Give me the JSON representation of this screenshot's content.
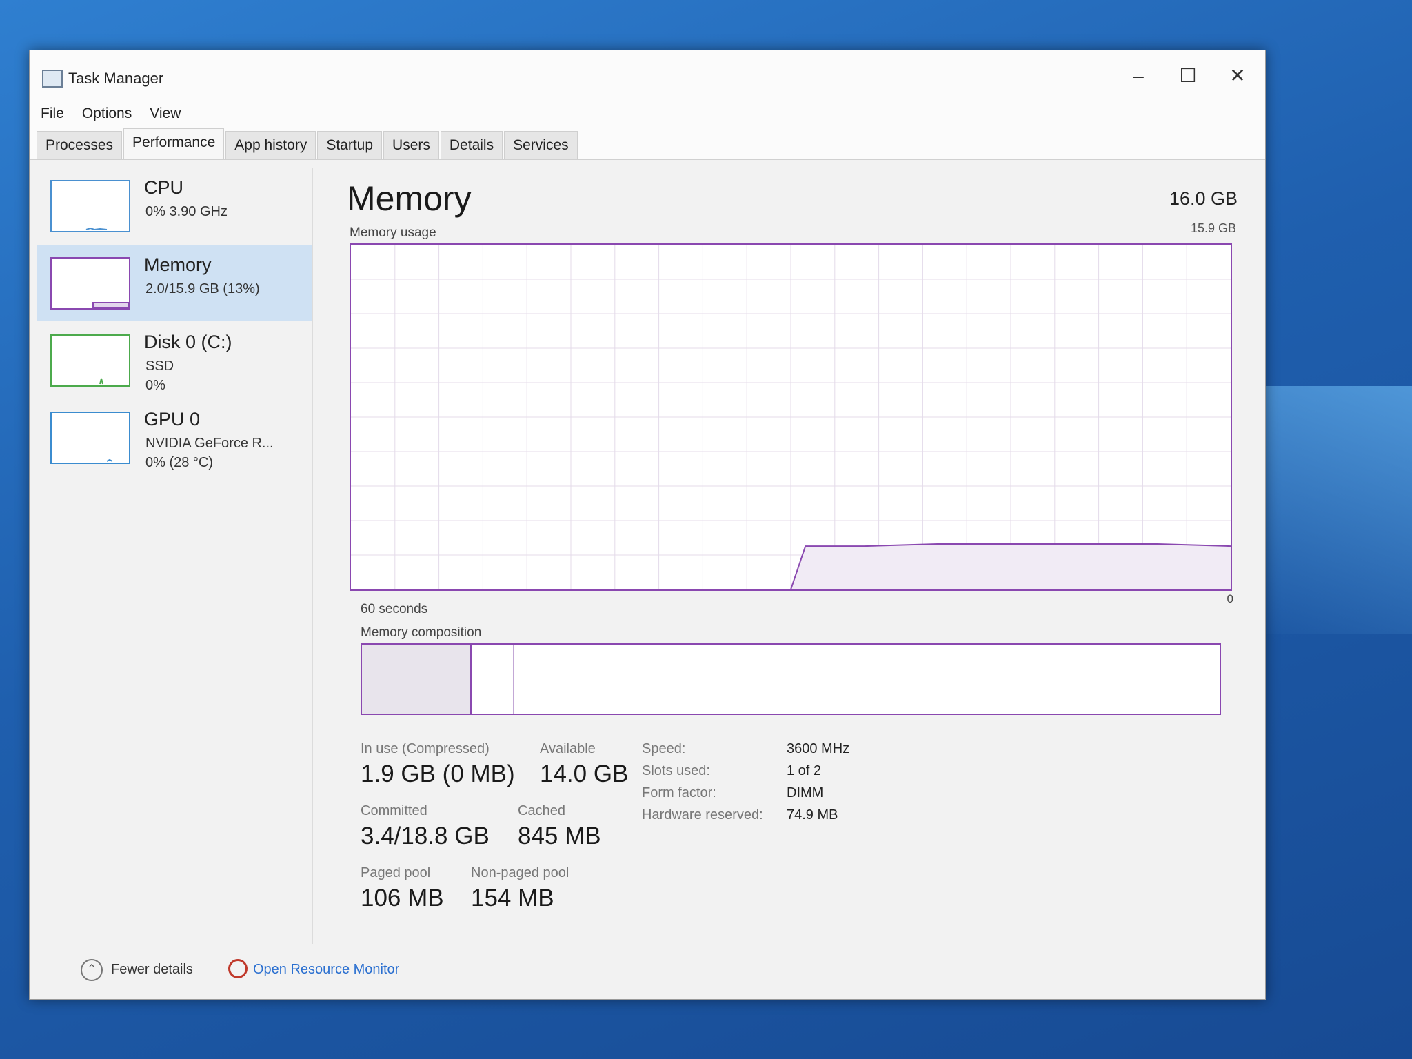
{
  "window": {
    "title": "Task Manager",
    "controls": {
      "minimize": "–",
      "maximize": "☐",
      "close": "✕"
    }
  },
  "menu": [
    "File",
    "Options",
    "View"
  ],
  "tabs": [
    "Processes",
    "Performance",
    "App history",
    "Startup",
    "Users",
    "Details",
    "Services"
  ],
  "active_tab": "Performance",
  "sidebar": {
    "items": [
      {
        "name": "CPU",
        "lines": [
          "0% 3.90 GHz"
        ]
      },
      {
        "name": "Memory",
        "lines": [
          "2.0/15.9 GB (13%)"
        ],
        "selected": true
      },
      {
        "name": "Disk 0 (C:)",
        "lines": [
          "SSD",
          "0%"
        ]
      },
      {
        "name": "GPU 0",
        "lines": [
          "NVIDIA GeForce R...",
          "0% (28 °C)"
        ]
      }
    ]
  },
  "memory": {
    "title": "Memory",
    "total": "16.0 GB",
    "usage_label": "Memory usage",
    "max_label": "15.9 GB",
    "time_label": "60 seconds",
    "zero_label": "0",
    "composition_label": "Memory composition",
    "stats": {
      "in_use_label": "In use (Compressed)",
      "in_use": "1.9 GB (0 MB)",
      "available_label": "Available",
      "available": "14.0 GB",
      "committed_label": "Committed",
      "committed": "3.4/18.8 GB",
      "cached_label": "Cached",
      "cached": "845 MB",
      "paged_label": "Paged pool",
      "paged": "106 MB",
      "nonpaged_label": "Non-paged pool",
      "nonpaged": "154 MB"
    },
    "details": {
      "speed_label": "Speed:",
      "speed": "3600 MHz",
      "slots_label": "Slots used:",
      "slots": "1 of 2",
      "form_label": "Form factor:",
      "form": "DIMM",
      "hw_label": "Hardware reserved:",
      "hw": "74.9 MB"
    }
  },
  "footer": {
    "fewer_details": "Fewer details",
    "open_resource_monitor": "Open Resource Monitor"
  },
  "colors": {
    "memory_accent": "#8a48b0",
    "cpu_accent": "#4a90d0",
    "disk_accent": "#4caa4c",
    "selection": "#cfe1f3",
    "link": "#2a6fd0"
  },
  "chart_data": {
    "type": "area",
    "title": "Memory usage",
    "xlabel": "60 seconds",
    "ylabel": "",
    "ylim": [
      0,
      15.9
    ],
    "x": [
      60,
      30,
      29,
      27,
      25,
      20,
      15,
      10,
      5,
      0
    ],
    "values": [
      0,
      0,
      2.0,
      2.0,
      2.0,
      2.1,
      2.1,
      2.1,
      2.1,
      2.0
    ]
  }
}
